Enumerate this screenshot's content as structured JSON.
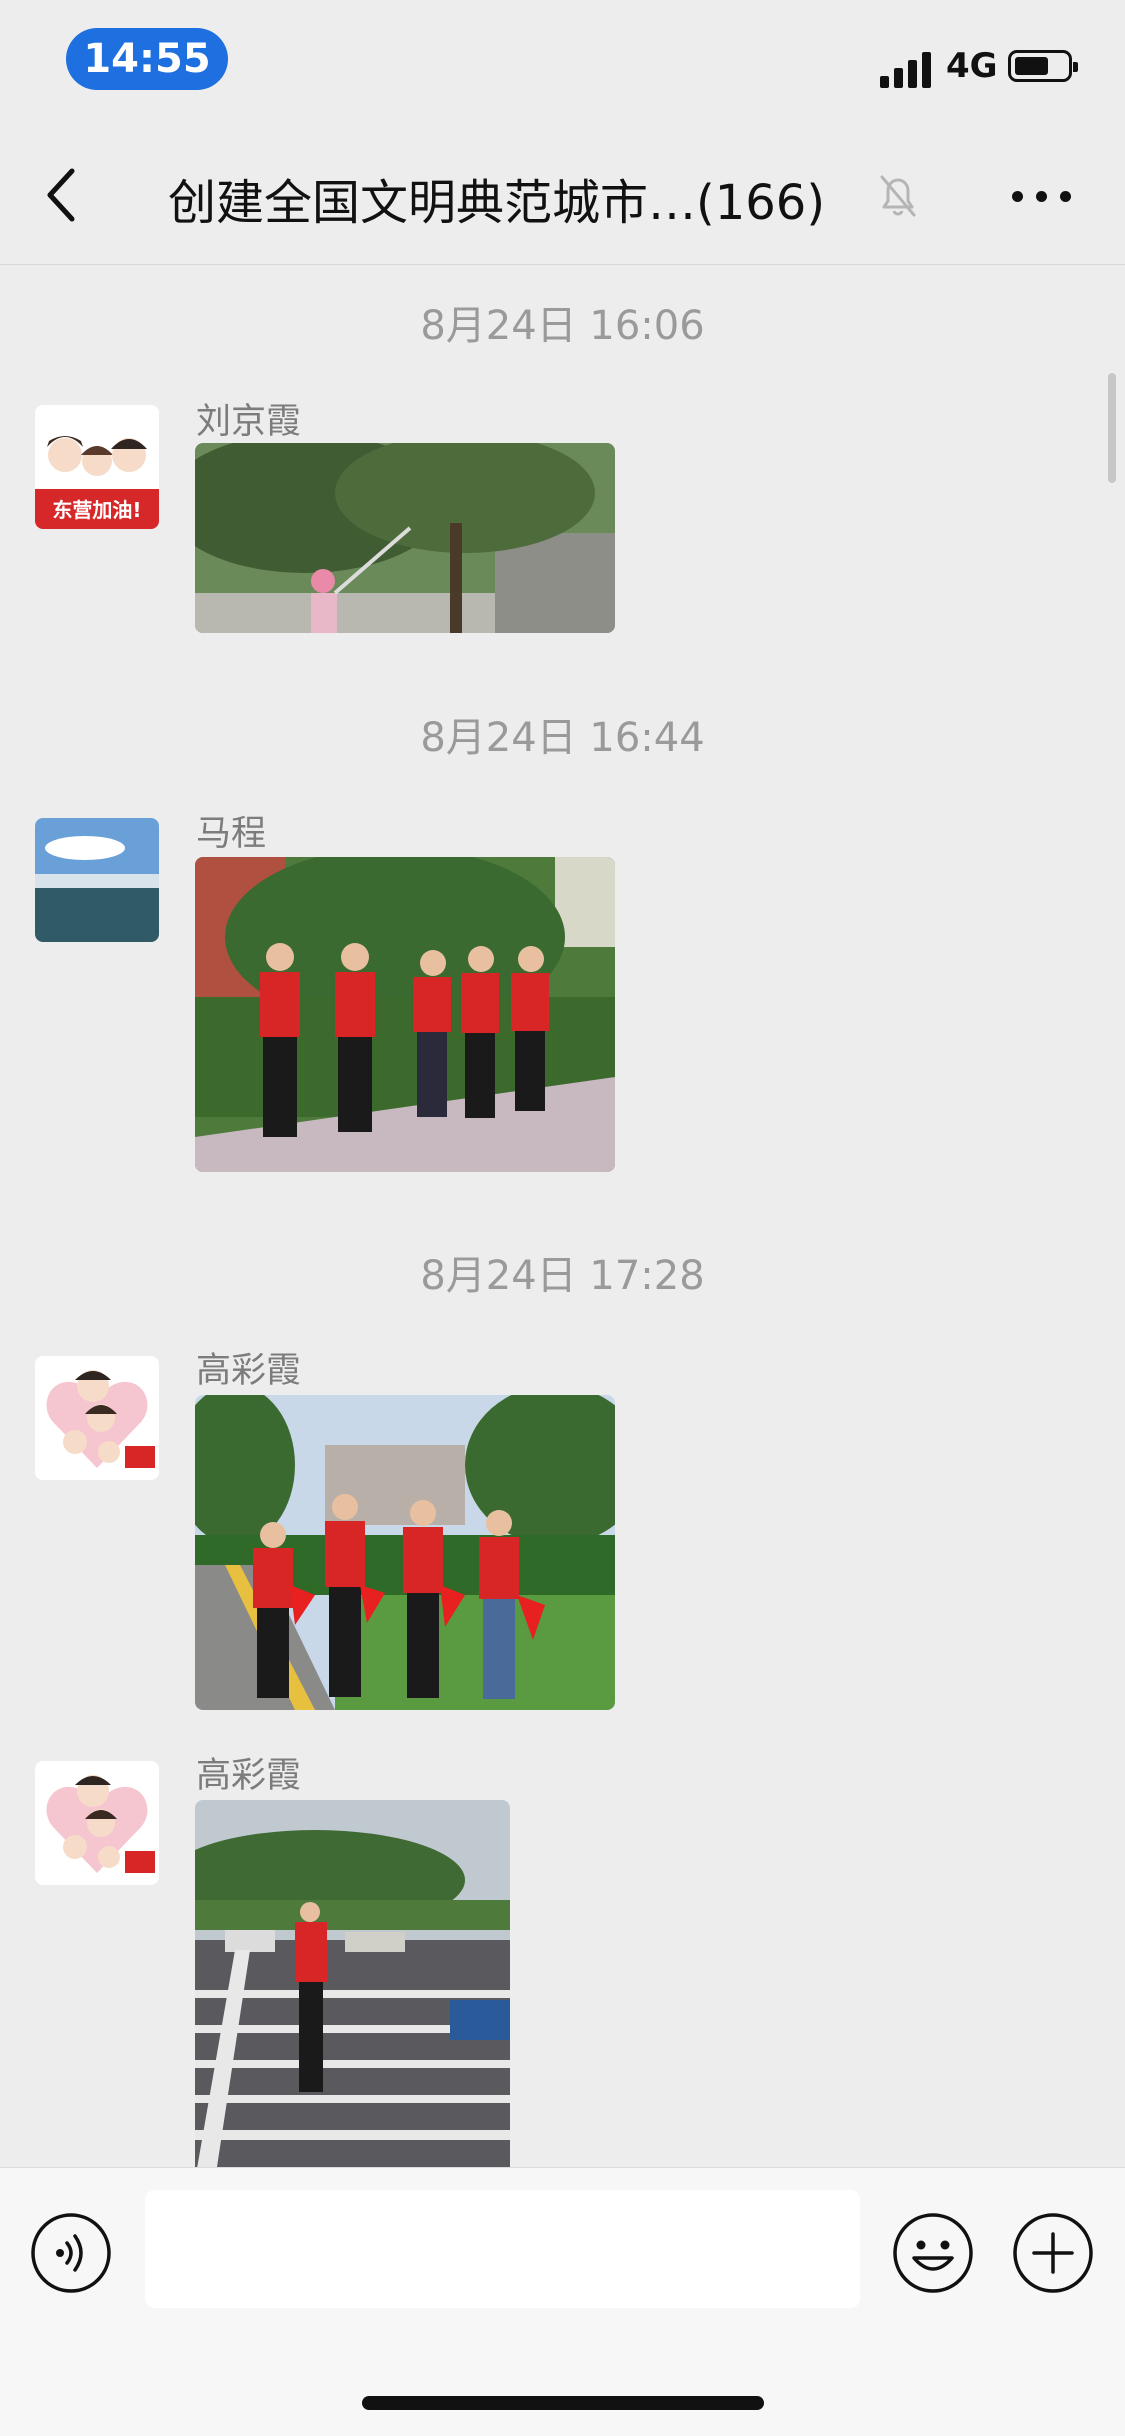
{
  "status_bar": {
    "time": "14:55",
    "network": "4G",
    "icons": [
      "signal-icon",
      "battery-icon"
    ]
  },
  "header": {
    "title": "创建全国文明典范城市…(166)",
    "icons": [
      "back-chevron-icon",
      "mute-bell-icon",
      "more-dots-icon"
    ]
  },
  "messages": [
    {
      "timestamp": "8月24日 16:06",
      "sender": "刘京霞",
      "avatar_text": "东营加油!",
      "avatar_desc": "cartoon-family-avatar",
      "image_desc": "volunteer pruning tree branch"
    },
    {
      "timestamp": "8月24日 16:44",
      "sender": "马程",
      "avatar_desc": "sea-landscape-avatar",
      "image_desc": "five volunteers in red vests standing"
    },
    {
      "timestamp": "8月24日 17:28",
      "sender": "高彩霞",
      "avatar_desc": "cartoon-couple-heart-avatar",
      "image_desc": "four volunteers with masks holding red flags"
    },
    {
      "sender": "高彩霞",
      "avatar_desc": "cartoon-couple-heart-avatar",
      "image_desc": "volunteer standing at road crosswalk"
    }
  ],
  "input_bar": {
    "placeholder": "",
    "icons": [
      "voice-icon",
      "emoji-icon",
      "plus-icon"
    ]
  },
  "colors": {
    "background": "#ededed",
    "time_pill": "#1e6fe0",
    "timestamp_text": "#9a9a9a",
    "sender_text": "#7c7c7c",
    "vest_red": "#d82525"
  }
}
